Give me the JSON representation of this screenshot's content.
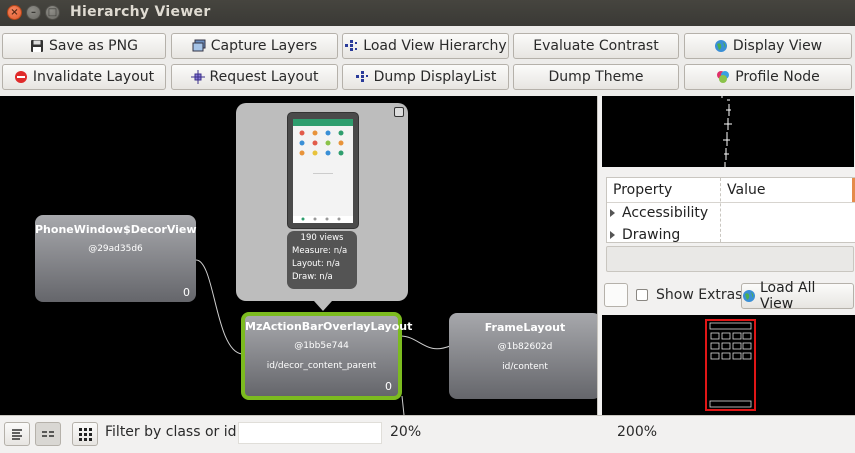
{
  "window": {
    "title": "Hierarchy Viewer",
    "controls": {
      "close": "×",
      "minimize": "–",
      "maximize": "□"
    }
  },
  "toolbar": {
    "row1": [
      {
        "label": "Save as PNG",
        "icon": "floppy-disk-icon"
      },
      {
        "label": "Capture Layers",
        "icon": "layers-icon"
      },
      {
        "label": "Load View Hierarchy",
        "icon": "hierarchy-icon"
      },
      {
        "label": "Evaluate Contrast",
        "icon": ""
      },
      {
        "label": "Display View",
        "icon": "globe-icon"
      }
    ],
    "row2": [
      {
        "label": "Invalidate Layout",
        "icon": "no-entry-icon"
      },
      {
        "label": "Request Layout",
        "icon": "request-layout-icon"
      },
      {
        "label": "Dump DisplayList",
        "icon": "displaylist-icon"
      },
      {
        "label": "Dump Theme",
        "icon": ""
      },
      {
        "label": "Profile Node",
        "icon": "profile-node-icon"
      }
    ]
  },
  "graph": {
    "nodes": [
      {
        "name": "PhoneWindow$DecorView",
        "hash": "@29ad35d6",
        "id": "",
        "count": "0"
      },
      {
        "name": "MzActionBarOverlayLayout",
        "hash": "@1bb5e744",
        "id": "id/decor_content_parent",
        "count": "0",
        "selected": true
      },
      {
        "name": "FrameLayout",
        "hash": "@1b82602d",
        "id": "id/content",
        "count": ""
      }
    ],
    "popup": {
      "views": "190 views",
      "measure": "Measure: n/a",
      "layout": "Layout: n/a",
      "draw": "Draw: n/a"
    }
  },
  "properties": {
    "columns": [
      "Property",
      "Value"
    ],
    "rows": [
      "Accessibility",
      "Drawing"
    ]
  },
  "extras": {
    "show_extras_label": "Show Extras",
    "show_extras_checked": false,
    "load_all_label": "Load All View"
  },
  "bottom": {
    "filter_label": "Filter by class or id:",
    "filter_value": "",
    "zoom_min": "20%",
    "zoom_max": "200%"
  },
  "colors": {
    "selected_border": "#7cbb1f",
    "overview_box": "#e01616",
    "canvas_bg": "#000000"
  }
}
